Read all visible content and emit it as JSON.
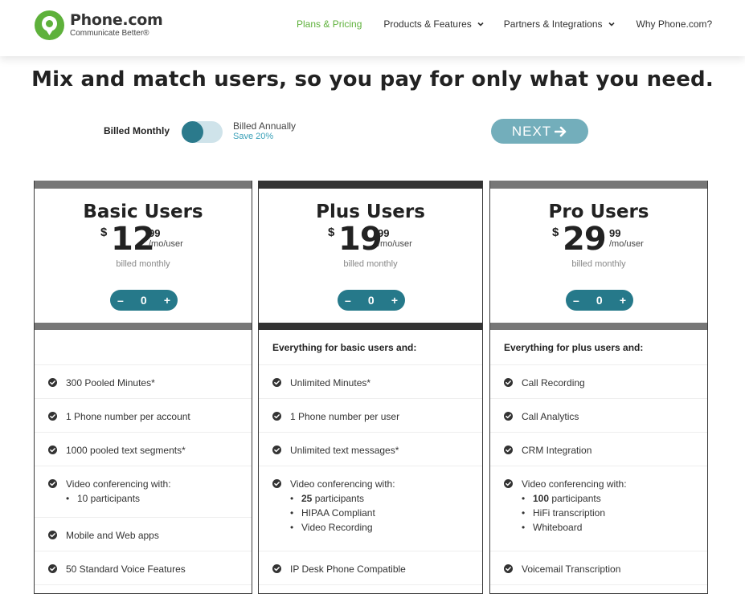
{
  "brand": {
    "name": "Phone.com",
    "tagline": "Communicate Better®",
    "color": "#5eb13b"
  },
  "nav": {
    "items": [
      {
        "label": "Plans & Pricing",
        "active": true,
        "dropdown": false
      },
      {
        "label": "Products & Features",
        "active": false,
        "dropdown": true
      },
      {
        "label": "Partners & Integrations",
        "active": false,
        "dropdown": true
      },
      {
        "label": "Why Phone.com?",
        "active": false,
        "dropdown": false
      }
    ]
  },
  "headline": "Mix and match users, so you pay for only what you need.",
  "billing": {
    "monthly_label": "Billed Monthly",
    "annually_label": "Billed Annually",
    "save_label": "Save 20%",
    "toggle_state": "monthly"
  },
  "next_button": {
    "label": "NEXT"
  },
  "plans": [
    {
      "title": "Basic Users",
      "currency": "$",
      "price_whole": "12",
      "price_cents": "99",
      "per": "/mo/user",
      "billed": "billed monthly",
      "qty": "0",
      "minus": "–",
      "plus": "+",
      "section_head": "",
      "features": [
        {
          "text": "300 Pooled Minutes*",
          "sub": []
        },
        {
          "text": "1 Phone number per account",
          "sub": []
        },
        {
          "text": "1000 pooled text segments*",
          "sub": []
        },
        {
          "text": "Video conferencing with:",
          "sub": [
            {
              "bold": "",
              "text": "10 participants"
            }
          ]
        },
        {
          "text": "Mobile and Web apps",
          "sub": []
        },
        {
          "text": "50 Standard Voice Features",
          "sub": []
        }
      ]
    },
    {
      "title": "Plus Users",
      "currency": "$",
      "price_whole": "19",
      "price_cents": "99",
      "per": "/mo/user",
      "billed": "billed monthly",
      "qty": "0",
      "minus": "–",
      "plus": "+",
      "section_head": "Everything for basic users and:",
      "features": [
        {
          "text": "Unlimited Minutes*",
          "sub": []
        },
        {
          "text": "1 Phone number per user",
          "sub": []
        },
        {
          "text": "Unlimited text messages*",
          "sub": []
        },
        {
          "text": "Video conferencing with:",
          "sub": [
            {
              "bold": "25",
              "text": " participants"
            },
            {
              "bold": "",
              "text": "HIPAA Compliant"
            },
            {
              "bold": "",
              "text": "Video Recording"
            }
          ]
        },
        {
          "text": "IP Desk Phone Compatible",
          "sub": []
        }
      ]
    },
    {
      "title": "Pro Users",
      "currency": "$",
      "price_whole": "29",
      "price_cents": "99",
      "per": "/mo/user",
      "billed": "billed monthly",
      "qty": "0",
      "minus": "–",
      "plus": "+",
      "section_head": "Everything for plus users and:",
      "features": [
        {
          "text": "Call Recording",
          "sub": []
        },
        {
          "text": "Call Analytics",
          "sub": []
        },
        {
          "text": "CRM Integration",
          "sub": []
        },
        {
          "text": "Video conferencing with:",
          "sub": [
            {
              "bold": "100",
              "text": " participants"
            },
            {
              "bold": "",
              "text": "HiFi transcription"
            },
            {
              "bold": "",
              "text": "Whiteboard"
            }
          ]
        },
        {
          "text": "Voicemail Transcription",
          "sub": []
        }
      ]
    }
  ]
}
